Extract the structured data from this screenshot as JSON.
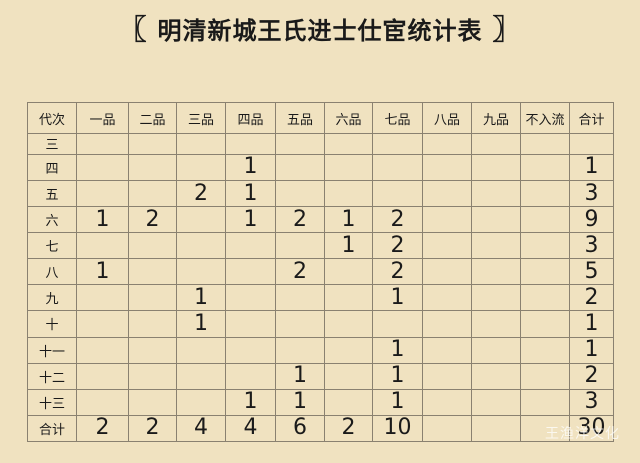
{
  "title": {
    "left": "〖",
    "text": "明清新城王氏进士仕宦统计表",
    "right": "〗"
  },
  "table": {
    "headers": [
      "代次",
      "一品",
      "二品",
      "三品",
      "四品",
      "五品",
      "六品",
      "七品",
      "八品",
      "九品",
      "不入流",
      "合计"
    ],
    "rows": [
      [
        "三",
        "",
        "",
        "",
        "",
        "",
        "",
        "",
        "",
        "",
        "",
        ""
      ],
      [
        "四",
        "",
        "",
        "",
        "1",
        "",
        "",
        "",
        "",
        "",
        "",
        "1"
      ],
      [
        "五",
        "",
        "",
        "2",
        "1",
        "",
        "",
        "",
        "",
        "",
        "",
        "3"
      ],
      [
        "六",
        "1",
        "2",
        "",
        "1",
        "2",
        "1",
        "2",
        "",
        "",
        "",
        "9"
      ],
      [
        "七",
        "",
        "",
        "",
        "",
        "",
        "1",
        "2",
        "",
        "",
        "",
        "3"
      ],
      [
        "八",
        "1",
        "",
        "",
        "",
        "2",
        "",
        "2",
        "",
        "",
        "",
        "5"
      ],
      [
        "九",
        "",
        "",
        "1",
        "",
        "",
        "",
        "1",
        "",
        "",
        "",
        "2"
      ],
      [
        "十",
        "",
        "",
        "1",
        "",
        "",
        "",
        "",
        "",
        "",
        "",
        "1"
      ],
      [
        "十一",
        "",
        "",
        "",
        "",
        "",
        "",
        "1",
        "",
        "",
        "",
        "1"
      ],
      [
        "十二",
        "",
        "",
        "",
        "",
        "1",
        "",
        "1",
        "",
        "",
        "",
        "2"
      ],
      [
        "十三",
        "",
        "",
        "",
        "1",
        "1",
        "",
        "1",
        "",
        "",
        "",
        "3"
      ],
      [
        "合计",
        "2",
        "2",
        "4",
        "4",
        "6",
        "2",
        "10",
        "",
        "",
        "",
        "30"
      ]
    ]
  },
  "watermark": "王渔洋文化"
}
